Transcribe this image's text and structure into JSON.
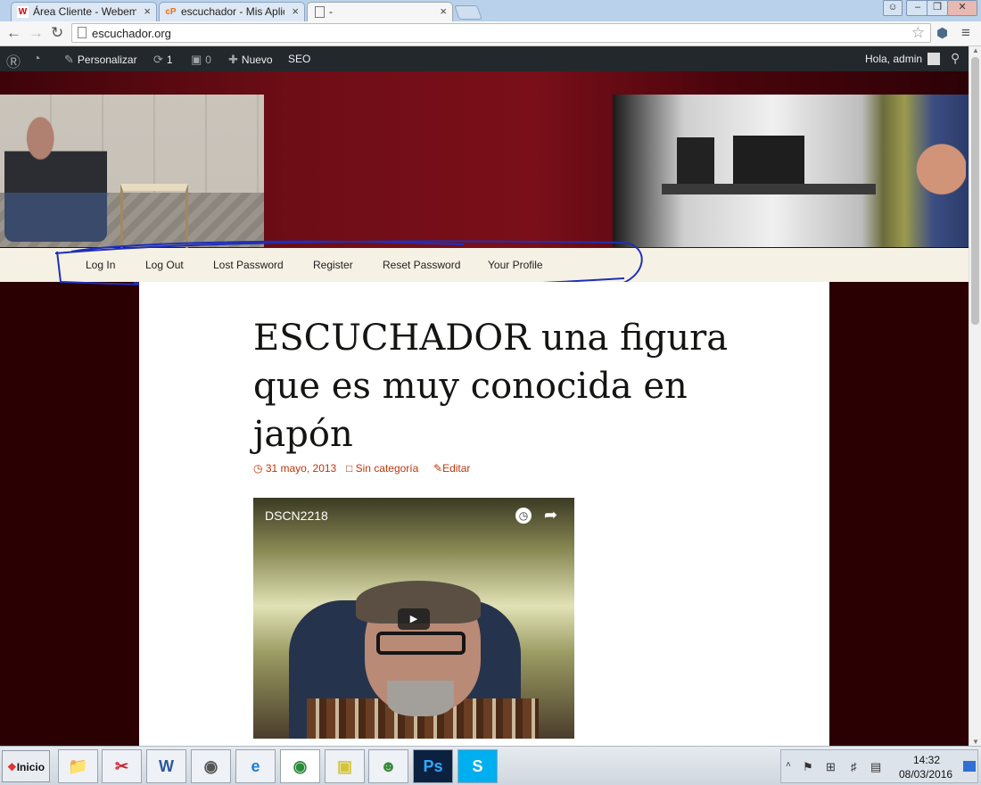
{
  "browser": {
    "tabs": [
      {
        "label": "Área Cliente - Webem",
        "favicon": "W"
      },
      {
        "label": "escuchador - Mis Aplic",
        "favicon": "cP"
      },
      {
        "label": "-",
        "favicon": "page-icon"
      }
    ],
    "url": "escuchador.org"
  },
  "adminbar": {
    "customize": "Personalizar",
    "updates_count": "1",
    "comments_count": "0",
    "new": "Nuevo",
    "seo": "SEO",
    "greeting": "Hola, admin"
  },
  "nav": {
    "links": [
      "Log In",
      "Log Out",
      "Lost Password",
      "Register",
      "Reset Password",
      "Your Profile"
    ]
  },
  "post": {
    "title": "ESCUCHADOR una figura que es muy conocida en japón",
    "date": "31 mayo, 2013",
    "category": "Sin categoría",
    "edit": "Editar"
  },
  "video": {
    "title": "DSCN2218"
  },
  "taskbar": {
    "start": "Inicio",
    "time": "14:32",
    "date": "08/03/2016"
  },
  "colors": {
    "header_red": "#7a0f19",
    "admin_bar": "#23282d",
    "link": "#bc360a",
    "annotation_pen": "#1f2fb8"
  }
}
